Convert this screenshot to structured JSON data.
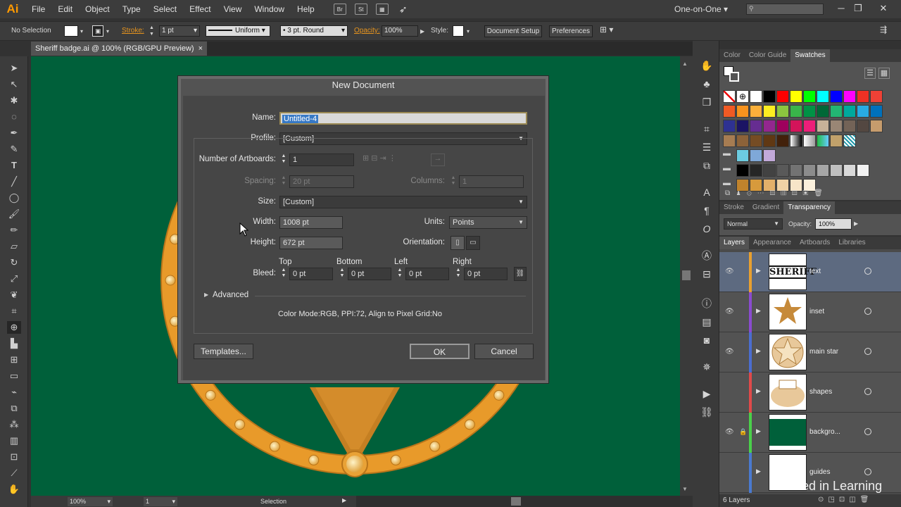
{
  "app": {
    "logo": "Ai",
    "workspace": "One-on-One",
    "window_controls": [
      "─",
      "❐",
      "✕"
    ]
  },
  "menu": {
    "items": [
      "File",
      "Edit",
      "Object",
      "Type",
      "Select",
      "Effect",
      "View",
      "Window",
      "Help"
    ],
    "icons": [
      "Br",
      "St"
    ]
  },
  "control": {
    "selection": "No Selection",
    "stroke_label": "Stroke:",
    "stroke_value": "1 pt",
    "profile": "Uniform",
    "brush": "3 pt. Round",
    "opacity_label": "Opacity:",
    "opacity_value": "100%",
    "style_label": "Style:",
    "document_setup": "Document Setup",
    "preferences": "Preferences"
  },
  "document": {
    "tab_title": "Sheriff badge.ai @ 100% (RGB/GPU Preview)",
    "close": "×"
  },
  "status": {
    "zoom": "100%",
    "artboard": "1",
    "tool": "Selection"
  },
  "dialog": {
    "title": "New Document",
    "name_label": "Name:",
    "name_value": "Untitled-4",
    "profile_label": "Profile:",
    "profile_value": "[Custom]",
    "artboards_label": "Number of Artboards:",
    "artboards_value": "1",
    "spacing_label": "Spacing:",
    "spacing_value": "20 pt",
    "columns_label": "Columns:",
    "columns_value": "1",
    "size_label": "Size:",
    "size_value": "[Custom]",
    "width_label": "Width:",
    "width_value": "1008 pt",
    "units_label": "Units:",
    "units_value": "Points",
    "height_label": "Height:",
    "height_value": "672 pt",
    "orientation_label": "Orientation:",
    "bleed_label": "Bleed:",
    "bleed_top_label": "Top",
    "bleed_bottom_label": "Bottom",
    "bleed_left_label": "Left",
    "bleed_right_label": "Right",
    "bleed_top": "0 pt",
    "bleed_bottom": "0 pt",
    "bleed_left": "0 pt",
    "bleed_right": "0 pt",
    "advanced_label": "Advanced",
    "info": "Color Mode:RGB, PPI:72, Align to Pixel Grid:No",
    "templates_button": "Templates...",
    "ok_button": "OK",
    "cancel_button": "Cancel"
  },
  "swatches_panel": {
    "tabs": [
      "Color",
      "Color Guide",
      "Swatches"
    ],
    "active": "Swatches"
  },
  "transparency_panel": {
    "tabs": [
      "Stroke",
      "Gradient",
      "Transparency"
    ],
    "active": "Transparency",
    "blend_mode": "Normal",
    "opacity_label": "Opacity:",
    "opacity_value": "100%"
  },
  "layers_panel": {
    "tabs": [
      "Layers",
      "Appearance",
      "Artboards",
      "Libraries"
    ],
    "active": "Layers",
    "layers": [
      {
        "name": "text",
        "thumb_text": "SHERIFF"
      },
      {
        "name": "inset"
      },
      {
        "name": "main star"
      },
      {
        "name": "shapes"
      },
      {
        "name": "backgro..."
      },
      {
        "name": "guides"
      }
    ],
    "count": "6 Layers"
  },
  "watermark": "Linked in Learning",
  "colors": {
    "canvas": "#00603a",
    "badge_gold": "#e89a2a",
    "accent": "#e7941e"
  }
}
